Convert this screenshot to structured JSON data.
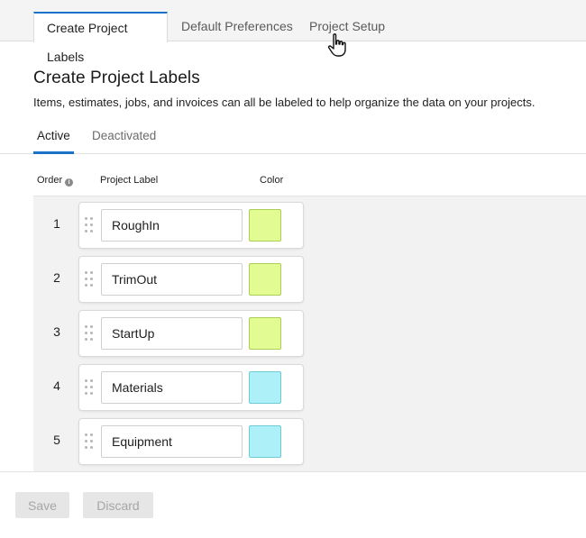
{
  "top_tabs": [
    {
      "label": "Create Project Labels",
      "active": true
    },
    {
      "label": "Default Preferences",
      "active": false
    },
    {
      "label": "Project Setup",
      "active": false
    }
  ],
  "page": {
    "title": "Create Project Labels",
    "subtitle": "Items, estimates, jobs, and invoices can all be labeled to help organize the data on your projects."
  },
  "sub_tabs": [
    {
      "label": "Active",
      "active": true
    },
    {
      "label": "Deactivated",
      "active": false
    }
  ],
  "columns": {
    "order": "Order",
    "label": "Project Label",
    "color": "Color",
    "info_icon": "i"
  },
  "rows": [
    {
      "order": "1",
      "label": "RoughIn",
      "color": "#e2fb92",
      "border": "#a9cf55"
    },
    {
      "order": "2",
      "label": "TrimOut",
      "color": "#e2fb92",
      "border": "#a9cf55"
    },
    {
      "order": "3",
      "label": "StartUp",
      "color": "#e2fb92",
      "border": "#a9cf55"
    },
    {
      "order": "4",
      "label": "Materials",
      "color": "#aef0f7",
      "border": "#6fcad6"
    },
    {
      "order": "5",
      "label": "Equipment",
      "color": "#aef0f7",
      "border": "#6fcad6"
    }
  ],
  "footer": {
    "save_label": "Save",
    "discard_label": "Discard"
  },
  "colors": {
    "accent": "#1a73c8"
  }
}
